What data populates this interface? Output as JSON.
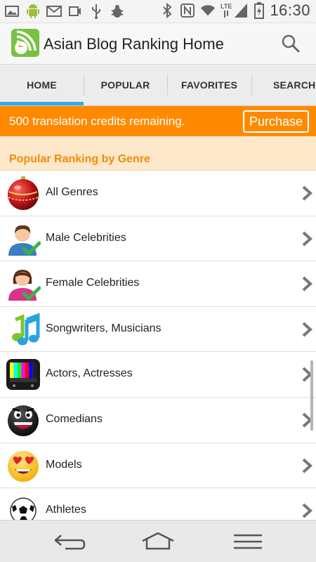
{
  "status_bar": {
    "time": "16:30",
    "left_icons": [
      "image-icon",
      "android-icon",
      "mail-icon",
      "sync-photo-icon",
      "usb-icon",
      "bug-icon"
    ],
    "right_icons": [
      "bluetooth-icon",
      "nfc-icon",
      "wifi-icon",
      "lte-signal-icon",
      "battery-charging-icon"
    ],
    "lte_label": "LTE"
  },
  "app_bar": {
    "title": "Asian Blog Ranking Home",
    "logo_icon": "rss-crown-logo-icon",
    "search_icon": "search-icon"
  },
  "tabs": [
    {
      "label": "HOME",
      "active": true
    },
    {
      "label": "POPULAR",
      "active": false
    },
    {
      "label": "FAVORITES",
      "active": false
    },
    {
      "label": "SEARCH",
      "active": false
    }
  ],
  "banner": {
    "text": "500 translation credits remaining.",
    "button_label": "Purchase"
  },
  "section": {
    "title": "Popular Ranking by Genre"
  },
  "genres": [
    {
      "label": "All Genres",
      "icon": "ornament-ball-icon"
    },
    {
      "label": "Male Celebrities",
      "icon": "male-user-check-icon"
    },
    {
      "label": "Female Celebrities",
      "icon": "female-user-check-icon"
    },
    {
      "label": "Songwriters, Musicians",
      "icon": "music-notes-icon"
    },
    {
      "label": "Actors, Actresses",
      "icon": "tv-color-bars-icon"
    },
    {
      "label": "Comedians",
      "icon": "laughing-face-icon"
    },
    {
      "label": "Models",
      "icon": "heart-eyes-face-icon"
    },
    {
      "label": "Athletes",
      "icon": "soccer-ball-icon"
    }
  ],
  "nav_bar": {
    "icons": [
      "back-icon",
      "home-icon",
      "menu-icon"
    ]
  },
  "colors": {
    "accent_orange": "#ff8a00",
    "section_bg": "#fde8c9",
    "section_text": "#f28a0a",
    "tab_indicator": "#33a9e0"
  }
}
